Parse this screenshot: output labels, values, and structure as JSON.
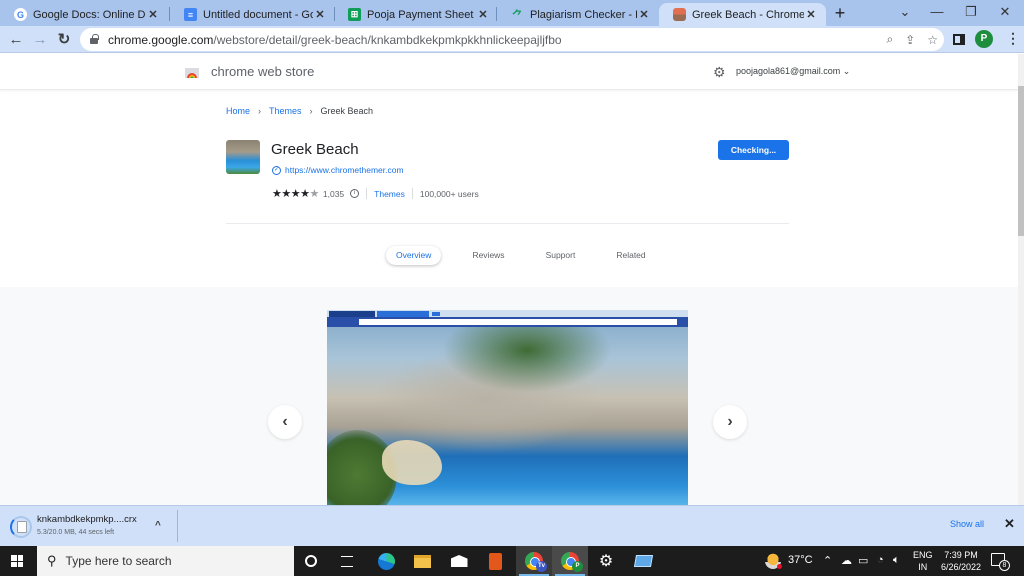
{
  "browser": {
    "tabs": [
      {
        "title": "Google Docs: Online Document",
        "icon": "google-g-icon",
        "active": false
      },
      {
        "title": "Untitled document - Google",
        "icon": "google-docs-icon",
        "active": false
      },
      {
        "title": "Pooja Payment Sheet - Goog",
        "icon": "google-sheets-icon",
        "active": false
      },
      {
        "title": "Plagiarism Checker - Free &",
        "icon": "plagiarism-checker-icon",
        "active": false
      },
      {
        "title": "Greek Beach - Chrome Web",
        "icon": "chrome-web-store-icon",
        "active": true
      }
    ],
    "new_tab_label": "+",
    "window_controls": {
      "tab_search": "⌄",
      "minimize": "—",
      "restore": "❐",
      "close": "✕"
    },
    "url_host": "chrome.google.com",
    "url_path": "/webstore/detail/greek-beach/knkambdkekpmkpkkhnlickeepajljfbo",
    "profile_initial": "P",
    "colors": {
      "tabstrip": "#a8c3ec",
      "toolbar": "#cfe0f8",
      "accent": "#1a73e8",
      "profile": "#1e8e3e"
    }
  },
  "store": {
    "title": "chrome web store",
    "account": "poojagola861@gmail.com",
    "breadcrumb": [
      {
        "label": "Home",
        "link": true
      },
      {
        "label": "Themes",
        "link": true
      },
      {
        "label": "Greek Beach",
        "link": false
      }
    ],
    "breadcrumb_sep": "›",
    "item": {
      "name": "Greek Beach",
      "site": "https://www.chromethemer.com",
      "rating": 4,
      "rating_max": 5,
      "rating_count": "1,035",
      "category": "Themes",
      "users": "100,000+ users",
      "action_label": "Checking..."
    },
    "tabs": [
      {
        "label": "Overview",
        "active": true
      },
      {
        "label": "Reviews",
        "active": false
      },
      {
        "label": "Support",
        "active": false
      },
      {
        "label": "Related",
        "active": false
      }
    ],
    "gallery": {
      "prev": "‹",
      "next": "›"
    }
  },
  "download": {
    "filename": "knkambdkekpmkp....crx",
    "status": "5.3/20.0 MB, 44 secs left",
    "progress_fraction": 0.265,
    "show_all": "Show all",
    "close": "✕"
  },
  "taskbar": {
    "search_placeholder": "Type here to search",
    "apps": [
      "cortana",
      "task-view",
      "edge",
      "file-explorer",
      "mail",
      "office",
      "chrome-tv",
      "chrome-p",
      "settings",
      "remote-desktop"
    ],
    "chrome_badges": [
      "Tv",
      "P"
    ],
    "temperature": "37°C",
    "lang_line1": "ENG",
    "lang_line2": "IN",
    "time": "7:39 PM",
    "date": "6/26/2022",
    "notification_count": "8"
  }
}
